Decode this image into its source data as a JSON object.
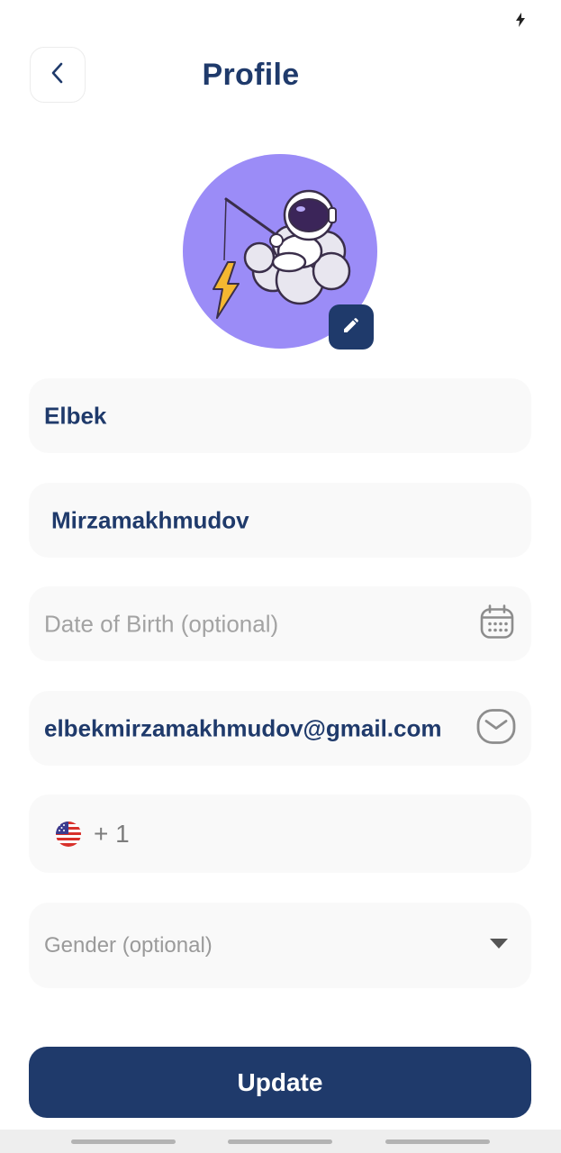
{
  "status_bar": {
    "icon": "charging-bolt-icon"
  },
  "header": {
    "title": "Profile",
    "back_icon": "chevron-left-icon"
  },
  "avatar": {
    "description_icon": "astronaut-fishing-avatar",
    "edit_icon": "pencil-icon"
  },
  "form": {
    "first_name": {
      "value": "Elbek"
    },
    "last_name": {
      "value": "Mirzamakhmudov"
    },
    "date_of_birth": {
      "placeholder": "Date of Birth (optional)",
      "icon": "calendar-icon"
    },
    "email": {
      "value": "elbekmirzamakhmudov@gmail.com",
      "icon": "mail-icon"
    },
    "phone": {
      "flag_icon": "us-flag-icon",
      "dial_code": "+ 1"
    },
    "gender": {
      "placeholder": "Gender  (optional)",
      "icon": "caret-down-icon"
    }
  },
  "actions": {
    "update_label": "Update"
  },
  "colors": {
    "primary": "#1f3a6b",
    "avatar_bg": "#9b8cf7",
    "field_bg": "#f9f9f9",
    "placeholder": "#a3a3a3"
  }
}
